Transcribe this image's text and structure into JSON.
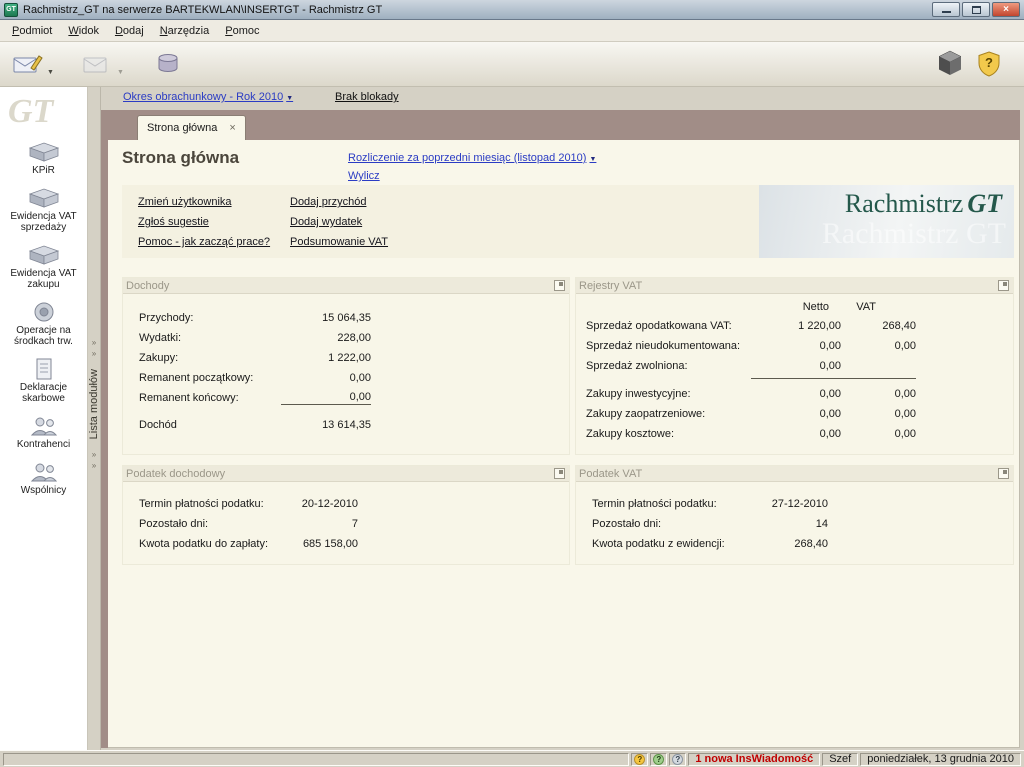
{
  "window": {
    "title": "Rachmistrz_GT na serwerze BARTEKWLAN\\INSERTGT - Rachmistrz GT"
  },
  "brand": {
    "short": "GT",
    "name": "Rachmistrz",
    "suffix": "GT",
    "watermark": "Rachmistrz GT"
  },
  "glyphs": {
    "caret": "▼",
    "close": "×",
    "tab_close": "×",
    "chev": "»",
    "q": "?"
  },
  "menu": {
    "items": [
      "Podmiot",
      "Widok",
      "Dodaj",
      "Narzędzia",
      "Pomoc"
    ]
  },
  "topbar": {
    "period": "Okres obrachunkowy - Rok 2010",
    "lock": "Brak blokady"
  },
  "tab": {
    "label": "Strona główna"
  },
  "sidebar": {
    "strip": "Lista modułów",
    "items": [
      "KPiR",
      "Ewidencja VAT sprzedaży",
      "Ewidencja VAT zakupu",
      "Operacje na środkach trw.",
      "Deklaracje skarbowe",
      "Kontrahenci",
      "Wspólnicy"
    ]
  },
  "main": {
    "heading": "Strona główna",
    "settlement": "Rozliczenie za poprzedni miesiąc (listopad 2010)",
    "calc": "Wylicz",
    "links_left": [
      "Zmień użytkownika",
      "Zgłoś sugestie",
      "Pomoc - jak zacząć prace?"
    ],
    "links_right": [
      "Dodaj przychód",
      "Dodaj wydatek",
      "Podsumowanie VAT"
    ]
  },
  "panels": {
    "dochody": {
      "title": "Dochody",
      "rows": [
        {
          "label": "Przychody:",
          "value": "15 064,35"
        },
        {
          "label": "Wydatki:",
          "value": "228,00"
        },
        {
          "label": "Zakupy:",
          "value": "1 222,00"
        },
        {
          "label": "Remanent początkowy:",
          "value": "0,00"
        },
        {
          "label": "Remanent końcowy:",
          "value": "0,00"
        }
      ],
      "total": {
        "label": "Dochód",
        "value": "13 614,35"
      }
    },
    "rejestry": {
      "title": "Rejestry VAT",
      "col_netto": "Netto",
      "col_vat": "VAT",
      "sales": [
        {
          "label": "Sprzedaż opodatkowana VAT:",
          "netto": "1 220,00",
          "vat": "268,40"
        },
        {
          "label": "Sprzedaż nieudokumentowana:",
          "netto": "0,00",
          "vat": "0,00"
        },
        {
          "label": "Sprzedaż zwolniona:",
          "netto": "0,00",
          "vat": ""
        }
      ],
      "purchases": [
        {
          "label": "Zakupy inwestycyjne:",
          "netto": "0,00",
          "vat": "0,00"
        },
        {
          "label": "Zakupy zaopatrzeniowe:",
          "netto": "0,00",
          "vat": "0,00"
        },
        {
          "label": "Zakupy kosztowe:",
          "netto": "0,00",
          "vat": "0,00"
        }
      ]
    },
    "podatek_dochodowy": {
      "title": "Podatek dochodowy",
      "rows": [
        {
          "label": "Termin płatności podatku:",
          "value": "20-12-2010"
        },
        {
          "label": "Pozostało dni:",
          "value": "7"
        },
        {
          "label": "Kwota podatku do zapłaty:",
          "value": "685 158,00"
        }
      ]
    },
    "podatek_vat": {
      "title": "Podatek VAT",
      "rows": [
        {
          "label": "Termin płatności podatku:",
          "value": "27-12-2010"
        },
        {
          "label": "Pozostało dni:",
          "value": "14"
        },
        {
          "label": "Kwota podatku z ewidencji:",
          "value": "268,40"
        }
      ]
    }
  },
  "statusbar": {
    "message": "1 nowa InsWiadomość",
    "user": "Szef",
    "date": "poniedziałek, 13 grudnia 2010"
  }
}
